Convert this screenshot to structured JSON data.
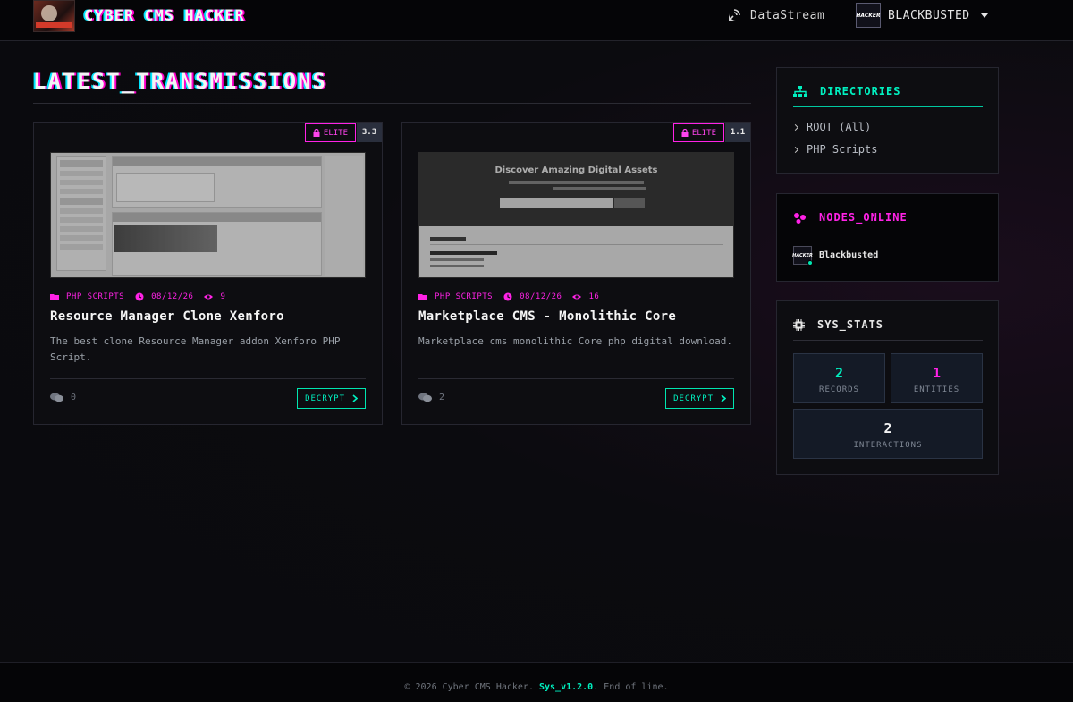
{
  "header": {
    "brand_name": "CYBER CMS HACKER",
    "nav_stream_label": "DataStream",
    "user_name": "BLACKBUSTED",
    "avatar_text": "HACKER"
  },
  "main": {
    "section_title": "LATEST_TRANSMISSIONS",
    "cards": [
      {
        "badge": "ELITE",
        "rating": "3.3",
        "thumb_labels": {
          "sidebar_title": "Categories"
        },
        "category": "PHP SCRIPTS",
        "date": "08/12/26",
        "views": "9",
        "title": "Resource Manager Clone Xenforo",
        "description": "The best clone Resource Manager addon Xenforo PHP Script.",
        "comments": "0",
        "button_label": "DECRYPT"
      },
      {
        "badge": "ELITE",
        "rating": "1.1",
        "thumb_labels": {
          "hero_title": "Discover Amazing Digital Assets"
        },
        "category": "PHP SCRIPTS",
        "date": "08/12/26",
        "views": "16",
        "title": "Marketplace CMS - Monolithic Core",
        "description": "Marketplace cms monolithic Core php digital download.",
        "comments": "2",
        "button_label": "DECRYPT"
      }
    ]
  },
  "sidebar": {
    "directories": {
      "title": "DIRECTORIES",
      "items": [
        {
          "label": "ROOT (All)"
        },
        {
          "label": "PHP Scripts"
        }
      ]
    },
    "nodes": {
      "title": "NODES_ONLINE",
      "user_name": "Blackbusted",
      "avatar_text": "HACKER"
    },
    "stats": {
      "title": "SYS_STATS",
      "records": {
        "value": "2",
        "label": "RECORDS"
      },
      "entities": {
        "value": "1",
        "label": "ENTITIES"
      },
      "interactions": {
        "value": "2",
        "label": "INTERACTIONS"
      }
    }
  },
  "footer": {
    "prefix": "© 2026 Cyber CMS Hacker.",
    "version": "Sys_v1.2.0",
    "suffix": "End of line."
  },
  "colors": {
    "accent_cyan": "#00f0c0",
    "accent_magenta": "#ff22e6",
    "background": "#0b0b0f"
  },
  "icons": [
    "satellite-dish-icon",
    "chevron-down-icon",
    "lock-icon",
    "folder-icon",
    "clock-icon",
    "eye-icon",
    "comments-icon",
    "chevron-right-icon",
    "sitemap-icon",
    "network-icon",
    "microchip-icon"
  ]
}
